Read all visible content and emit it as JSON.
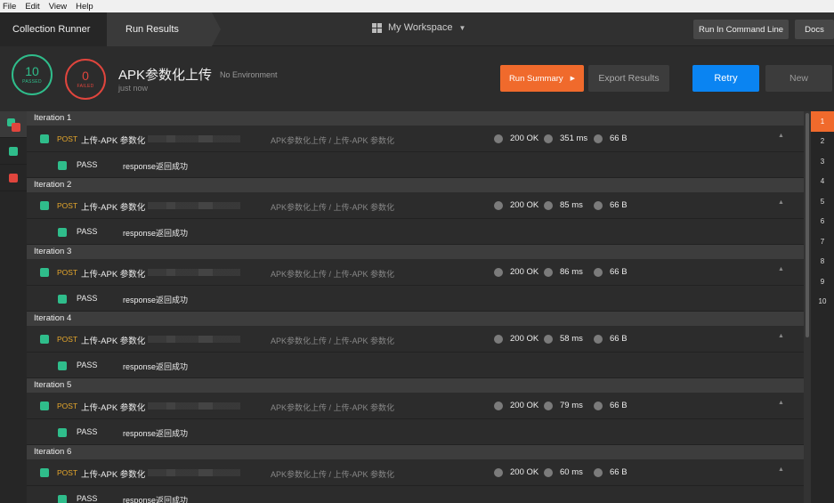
{
  "menu": [
    "File",
    "Edit",
    "View",
    "Help"
  ],
  "nav": {
    "collection_runner": "Collection Runner",
    "run_results": "Run Results",
    "workspace": "My Workspace",
    "run_in_command_line": "Run In Command Line",
    "docs": "Docs"
  },
  "summary": {
    "passed_count": "10",
    "passed_label": "PASSED",
    "failed_count": "0",
    "failed_label": "FAILED",
    "title": "APK参数化上传",
    "environment": "No Environment",
    "time": "just now",
    "run_summary": "Run Summary",
    "export_results": "Export Results",
    "retry": "Retry",
    "new": "New"
  },
  "iterations": [
    {
      "label": "Iteration 1",
      "method": "POST",
      "name": "上传-APK 参数化",
      "path": "APK参数化上传 / 上传-APK 参数化",
      "status": "200 OK",
      "time": "351 ms",
      "size": "66 B",
      "test_result": "PASS",
      "test_name": "response返回成功"
    },
    {
      "label": "Iteration 2",
      "method": "POST",
      "name": "上传-APK 参数化",
      "path": "APK参数化上传 / 上传-APK 参数化",
      "status": "200 OK",
      "time": "85 ms",
      "size": "66 B",
      "test_result": "PASS",
      "test_name": "response返回成功"
    },
    {
      "label": "Iteration 3",
      "method": "POST",
      "name": "上传-APK 参数化",
      "path": "APK参数化上传 / 上传-APK 参数化",
      "status": "200 OK",
      "time": "86 ms",
      "size": "66 B",
      "test_result": "PASS",
      "test_name": "response返回成功"
    },
    {
      "label": "Iteration 4",
      "method": "POST",
      "name": "上传-APK 参数化",
      "path": "APK参数化上传 / 上传-APK 参数化",
      "status": "200 OK",
      "time": "58 ms",
      "size": "66 B",
      "test_result": "PASS",
      "test_name": "response返回成功"
    },
    {
      "label": "Iteration 5",
      "method": "POST",
      "name": "上传-APK 参数化",
      "path": "APK参数化上传 / 上传-APK 参数化",
      "status": "200 OK",
      "time": "79 ms",
      "size": "66 B",
      "test_result": "PASS",
      "test_name": "response返回成功"
    },
    {
      "label": "Iteration 6",
      "method": "POST",
      "name": "上传-APK 参数化",
      "path": "APK参数化上传 / 上传-APK 参数化",
      "status": "200 OK",
      "time": "60 ms",
      "size": "66 B",
      "test_result": "PASS",
      "test_name": "response返回成功"
    }
  ],
  "iteration_numbers": [
    "1",
    "2",
    "3",
    "4",
    "5",
    "6",
    "7",
    "8",
    "9",
    "10"
  ],
  "colors": {
    "pass": "#2fbd8b",
    "fail": "#e0453d",
    "accent": "#f06a2c",
    "primary": "#0a84f2"
  }
}
